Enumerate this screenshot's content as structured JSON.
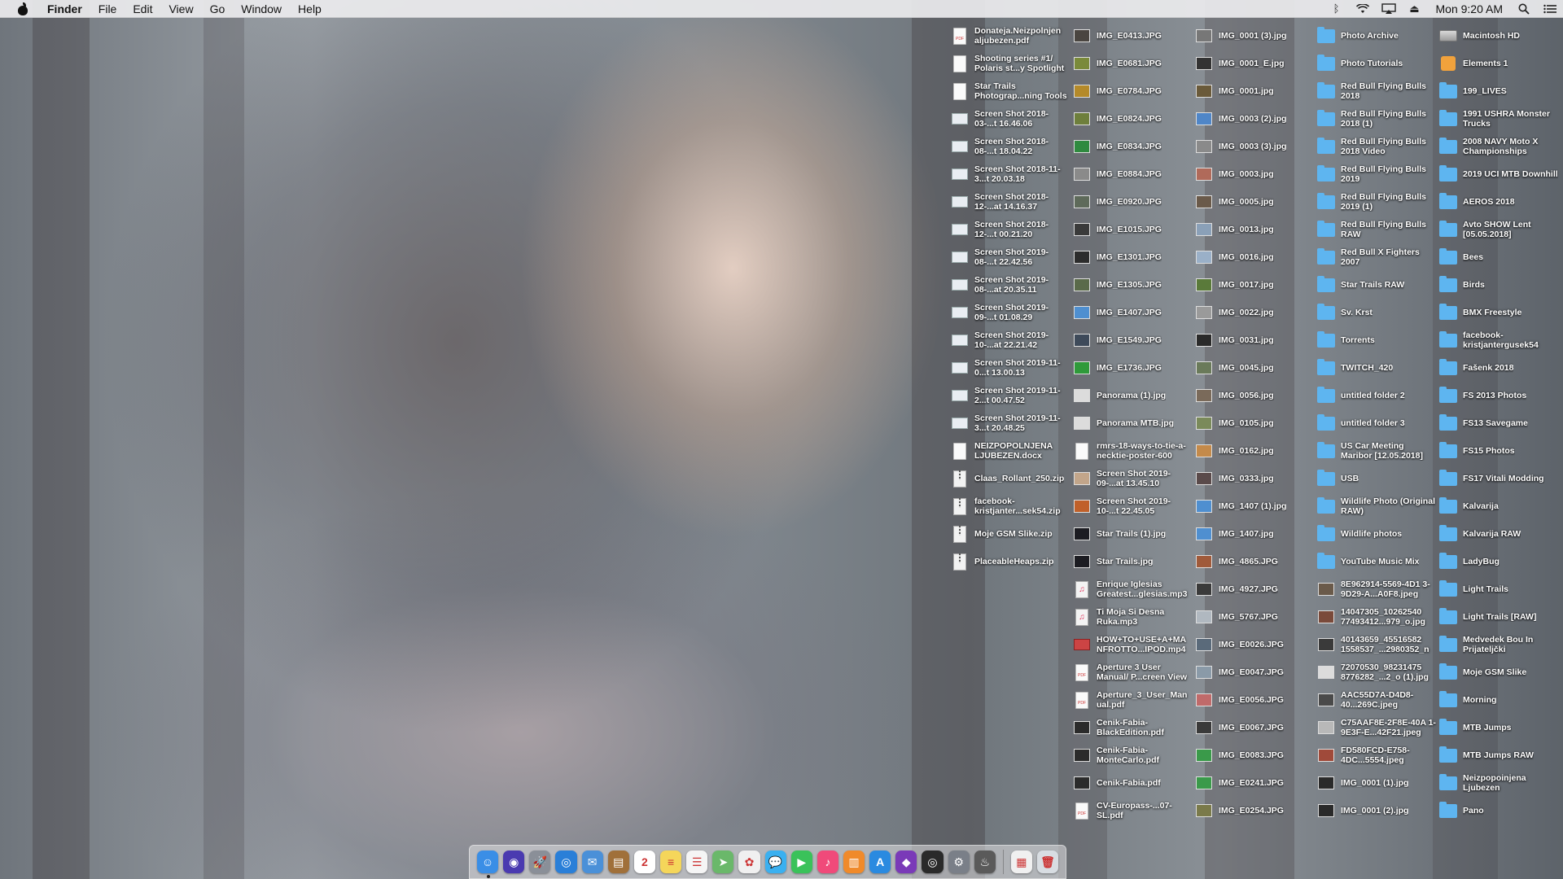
{
  "menubar": {
    "app_name": "Finder",
    "menus": [
      "File",
      "Edit",
      "View",
      "Go",
      "Window",
      "Help"
    ],
    "clock": "Mon 9:20 AM",
    "status_icons": [
      "bluetooth-icon",
      "wifi-icon",
      "airplay-icon",
      "eject-icon",
      "spotlight-search-icon",
      "notification-center-icon"
    ]
  },
  "desktop": {
    "columns": [
      {
        "items": [
          {
            "label": "Donateja.Neizpolnjen aljubezen.pdf",
            "icon": "pdf-icon"
          },
          {
            "label": "Shooting series #1/ Polaris st...y Spotlight",
            "icon": "document-icon"
          },
          {
            "label": "Star Trails Photograp...ning Tools",
            "icon": "document-icon"
          },
          {
            "label": "Screen Shot 2018-03-...t 16.46.06",
            "icon": "screenshot-icon"
          },
          {
            "label": "Screen Shot 2018-08-...t 18.04.22",
            "icon": "screenshot-icon"
          },
          {
            "label": "Screen Shot 2018-11-3...t 20.03.18",
            "icon": "screenshot-icon"
          },
          {
            "label": "Screen Shot 2018-12-...at 14.16.37",
            "icon": "screenshot-icon"
          },
          {
            "label": "Screen Shot 2018-12-...t 00.21.20",
            "icon": "screenshot-icon"
          },
          {
            "label": "Screen Shot 2019-08-...t 22.42.56",
            "icon": "screenshot-icon"
          },
          {
            "label": "Screen Shot 2019-08-...at 20.35.11",
            "icon": "screenshot-icon"
          },
          {
            "label": "Screen Shot 2019-09-...t 01.08.29",
            "icon": "screenshot-icon"
          },
          {
            "label": "Screen Shot 2019-10-...at 22.21.42",
            "icon": "screenshot-icon"
          },
          {
            "label": "Screen Shot 2019-11-0...t 13.00.13",
            "icon": "screenshot-icon"
          },
          {
            "label": "Screen Shot 2019-11-2...t 00.47.52",
            "icon": "screenshot-icon"
          },
          {
            "label": "Screen Shot 2019-11-3...t 20.48.25",
            "icon": "screenshot-icon"
          },
          {
            "label": "NEIZPOPOLNJENA LJUBEZEN.docx",
            "icon": "document-icon"
          },
          {
            "label": "Claas_Rollant_250.zip",
            "icon": "zip-icon"
          },
          {
            "label": "facebook-kristjanter...sek54.zip",
            "icon": "zip-icon"
          },
          {
            "label": "Moje GSM Slike.zip",
            "icon": "zip-icon"
          },
          {
            "label": "PlaceableHeaps.zip",
            "icon": "zip-icon"
          }
        ]
      },
      {
        "items": [
          {
            "label": "IMG_E0413.JPG",
            "icon": "image-icon",
            "tint": "#4a4540"
          },
          {
            "label": "IMG_E0681.JPG",
            "icon": "image-icon",
            "tint": "#7a8a3a"
          },
          {
            "label": "IMG_E0784.JPG",
            "icon": "image-icon",
            "tint": "#b58a2a"
          },
          {
            "label": "IMG_E0824.JPG",
            "icon": "image-icon",
            "tint": "#6e7f3c"
          },
          {
            "label": "IMG_E0834.JPG",
            "icon": "image-icon",
            "tint": "#2f8a3f"
          },
          {
            "label": "IMG_E0884.JPG",
            "icon": "image-icon",
            "tint": "#8a8a8a"
          },
          {
            "label": "IMG_E0920.JPG",
            "icon": "image-icon",
            "tint": "#5e6a5a"
          },
          {
            "label": "IMG_E1015.JPG",
            "icon": "image-icon",
            "tint": "#3a3a3a"
          },
          {
            "label": "IMG_E1301.JPG",
            "icon": "image-icon",
            "tint": "#2c2c2c"
          },
          {
            "label": "IMG_E1305.JPG",
            "icon": "image-icon",
            "tint": "#5a6a4a"
          },
          {
            "label": "IMG_E1407.JPG",
            "icon": "image-icon",
            "tint": "#4f8fd0"
          },
          {
            "label": "IMG_E1549.JPG",
            "icon": "image-icon",
            "tint": "#3e4a5a"
          },
          {
            "label": "IMG_E1736.JPG",
            "icon": "image-icon",
            "tint": "#2f9a3a"
          },
          {
            "label": "Panorama (1).jpg",
            "icon": "image-icon",
            "tint": "#dcdcdc"
          },
          {
            "label": "Panorama MTB.jpg",
            "icon": "image-icon",
            "tint": "#dcdcdc"
          },
          {
            "label": "rmrs-18-ways-to-tie-a-necktie-poster-600",
            "icon": "document-icon"
          },
          {
            "label": "Screen Shot 2019-09-...at 13.45.10",
            "icon": "image-icon",
            "tint": "#c2a58a"
          },
          {
            "label": "Screen Shot 2019-10-...t 22.45.05",
            "icon": "image-icon",
            "tint": "#c0602a"
          },
          {
            "label": "Star Trails (1).jpg",
            "icon": "image-icon",
            "tint": "#1c1c22"
          },
          {
            "label": "Star Trails.jpg",
            "icon": "image-icon",
            "tint": "#1c1c22"
          },
          {
            "label": "Enrique Iglesias Greatest...glesias.mp3",
            "icon": "audio-icon"
          },
          {
            "label": "Ti Moja Si Desna Ruka.mp3",
            "icon": "audio-icon"
          },
          {
            "label": "HOW+TO+USE+A+MA NFROTTO...IPOD.mp4",
            "icon": "video-icon"
          },
          {
            "label": "Aperture 3 User Manual/ P...creen View",
            "icon": "pdf-icon"
          },
          {
            "label": "Aperture_3_User_Man ual.pdf",
            "icon": "pdf-icon"
          },
          {
            "label": "Cenik-Fabia-BlackEdition.pdf",
            "icon": "image-icon",
            "tint": "#2b2b2b"
          },
          {
            "label": "Cenik-Fabia-MonteCarlo.pdf",
            "icon": "image-icon",
            "tint": "#2b2b2b"
          },
          {
            "label": "Cenik-Fabia.pdf",
            "icon": "image-icon",
            "tint": "#2b2b2b"
          },
          {
            "label": "CV-Europass-...07-SL.pdf",
            "icon": "pdf-icon"
          }
        ]
      },
      {
        "items": [
          {
            "label": "IMG_0001 (3).jpg",
            "icon": "image-icon",
            "tint": "#777777"
          },
          {
            "label": "IMG_0001_E.jpg",
            "icon": "image-icon",
            "tint": "#333333"
          },
          {
            "label": "IMG_0001.jpg",
            "icon": "image-icon",
            "tint": "#6a5a3a"
          },
          {
            "label": "IMG_0003 (2).jpg",
            "icon": "image-icon",
            "tint": "#4f86c8"
          },
          {
            "label": "IMG_0003 (3).jpg",
            "icon": "image-icon",
            "tint": "#8a8a8a"
          },
          {
            "label": "IMG_0003.jpg",
            "icon": "image-icon",
            "tint": "#b06a5a"
          },
          {
            "label": "IMG_0005.jpg",
            "icon": "image-icon",
            "tint": "#6a5a4a"
          },
          {
            "label": "IMG_0013.jpg",
            "icon": "image-icon",
            "tint": "#8aa0b8"
          },
          {
            "label": "IMG_0016.jpg",
            "icon": "image-icon",
            "tint": "#9ab0c8"
          },
          {
            "label": "IMG_0017.jpg",
            "icon": "image-icon",
            "tint": "#5a7a3a"
          },
          {
            "label": "IMG_0022.jpg",
            "icon": "image-icon",
            "tint": "#9a9a9a"
          },
          {
            "label": "IMG_0031.jpg",
            "icon": "image-icon",
            "tint": "#2a2a2a"
          },
          {
            "label": "IMG_0045.jpg",
            "icon": "image-icon",
            "tint": "#6a7a5a"
          },
          {
            "label": "IMG_0056.jpg",
            "icon": "image-icon",
            "tint": "#7a6a5a"
          },
          {
            "label": "IMG_0105.jpg",
            "icon": "image-icon",
            "tint": "#7a8a5a"
          },
          {
            "label": "IMG_0162.jpg",
            "icon": "image-icon",
            "tint": "#c48a4a"
          },
          {
            "label": "IMG_0333.jpg",
            "icon": "image-icon",
            "tint": "#5a4a4a"
          },
          {
            "label": "IMG_1407 (1).jpg",
            "icon": "image-icon",
            "tint": "#4f8fd0"
          },
          {
            "label": "IMG_1407.jpg",
            "icon": "image-icon",
            "tint": "#4f8fd0"
          },
          {
            "label": "IMG_4865.JPG",
            "icon": "image-icon",
            "tint": "#a05a3a"
          },
          {
            "label": "IMG_4927.JPG",
            "icon": "image-icon",
            "tint": "#3a3a3a"
          },
          {
            "label": "IMG_5767.JPG",
            "icon": "image-icon",
            "tint": "#b0b8c0"
          },
          {
            "label": "IMG_E0026.JPG",
            "icon": "image-icon",
            "tint": "#5a6a7a"
          },
          {
            "label": "IMG_E0047.JPG",
            "icon": "image-icon",
            "tint": "#8a9aa8"
          },
          {
            "label": "IMG_E0056.JPG",
            "icon": "image-icon",
            "tint": "#c06a6a"
          },
          {
            "label": "IMG_E0067.JPG",
            "icon": "image-icon",
            "tint": "#3a3a3a"
          },
          {
            "label": "IMG_E0083.JPG",
            "icon": "image-icon",
            "tint": "#3a9a4a"
          },
          {
            "label": "IMG_E0241.JPG",
            "icon": "image-icon",
            "tint": "#3a9a4a"
          },
          {
            "label": "IMG_E0254.JPG",
            "icon": "image-icon",
            "tint": "#7a7a4a"
          }
        ]
      },
      {
        "items": [
          {
            "label": "Photo Archive",
            "icon": "folder-icon"
          },
          {
            "label": "Photo Tutorials",
            "icon": "folder-icon"
          },
          {
            "label": "Red Bull Flying Bulls 2018",
            "icon": "folder-icon"
          },
          {
            "label": "Red Bull Flying Bulls 2018 (1)",
            "icon": "folder-icon"
          },
          {
            "label": "Red Bull Flying Bulls 2018 Video",
            "icon": "folder-icon"
          },
          {
            "label": "Red Bull Flying Bulls 2019",
            "icon": "folder-icon"
          },
          {
            "label": "Red Bull Flying Bulls 2019 (1)",
            "icon": "folder-icon"
          },
          {
            "label": "Red Bull Flying Bulls RAW",
            "icon": "folder-icon"
          },
          {
            "label": "Red Bull X Fighters 2007",
            "icon": "folder-icon"
          },
          {
            "label": "Star Trails RAW",
            "icon": "folder-icon"
          },
          {
            "label": "Sv. Krst",
            "icon": "folder-icon"
          },
          {
            "label": "Torrents",
            "icon": "folder-icon"
          },
          {
            "label": "TWITCH_420",
            "icon": "folder-icon"
          },
          {
            "label": "untitled folder 2",
            "icon": "folder-icon"
          },
          {
            "label": "untitled folder 3",
            "icon": "folder-icon"
          },
          {
            "label": "US Car Meeting Maribor [12.05.2018]",
            "icon": "folder-icon"
          },
          {
            "label": "USB",
            "icon": "folder-icon"
          },
          {
            "label": "Wildlife Photo (Original RAW)",
            "icon": "folder-icon"
          },
          {
            "label": "Wildlife photos",
            "icon": "folder-icon"
          },
          {
            "label": "YouTube Music Mix",
            "icon": "folder-icon"
          },
          {
            "label": "8E962914-5569-4D1 3-9D29-A...A0F8.jpeg",
            "icon": "image-icon",
            "tint": "#6a5a4a"
          },
          {
            "label": "14047305_10262540 77493412...979_o.jpg",
            "icon": "image-icon",
            "tint": "#7a4a3a"
          },
          {
            "label": "40143659_45516582 1558537_...2980352_n",
            "icon": "image-icon",
            "tint": "#3a3a3a"
          },
          {
            "label": "72070530_98231475 8776282_...2_o (1).jpg",
            "icon": "image-icon",
            "tint": "#dcdcdc"
          },
          {
            "label": "AAC55D7A-D4D8-40...269C.jpeg",
            "icon": "image-icon",
            "tint": "#4a4a4a"
          },
          {
            "label": "C75AAF8E-2F8E-40A 1-9E3F-E...42F21.jpeg",
            "icon": "image-icon",
            "tint": "#b8b8b8"
          },
          {
            "label": "FD580FCD-E758-4DC...5554.jpeg",
            "icon": "image-icon",
            "tint": "#a04a3a"
          },
          {
            "label": "IMG_0001 (1).jpg",
            "icon": "image-icon",
            "tint": "#2a2a2a"
          },
          {
            "label": "IMG_0001 (2).jpg",
            "icon": "image-icon",
            "tint": "#2a2a2a"
          }
        ]
      },
      {
        "items": [
          {
            "label": "Macintosh HD",
            "icon": "hard-drive-icon"
          },
          {
            "label": "Elements 1",
            "icon": "app-icon"
          },
          {
            "label": "199_LIVES",
            "icon": "folder-icon"
          },
          {
            "label": "1991 USHRA Monster Trucks",
            "icon": "folder-icon"
          },
          {
            "label": "2008 NAVY Moto X Championships",
            "icon": "folder-icon"
          },
          {
            "label": "2019 UCI MTB Downhill",
            "icon": "folder-icon"
          },
          {
            "label": "AEROS 2018",
            "icon": "folder-icon"
          },
          {
            "label": "Avto SHOW Lent [05.05.2018]",
            "icon": "folder-icon"
          },
          {
            "label": "Bees",
            "icon": "folder-icon"
          },
          {
            "label": "Birds",
            "icon": "folder-icon"
          },
          {
            "label": "BMX Freestyle",
            "icon": "folder-icon"
          },
          {
            "label": "facebook-kristjantergusek54",
            "icon": "folder-icon"
          },
          {
            "label": "Fašenk 2018",
            "icon": "folder-icon"
          },
          {
            "label": "FS 2013 Photos",
            "icon": "folder-icon"
          },
          {
            "label": "FS13 Savegame",
            "icon": "folder-icon"
          },
          {
            "label": "FS15 Photos",
            "icon": "folder-icon"
          },
          {
            "label": "FS17 Vitali Modding",
            "icon": "folder-icon"
          },
          {
            "label": "Kalvarija",
            "icon": "folder-icon"
          },
          {
            "label": "Kalvarija RAW",
            "icon": "folder-icon"
          },
          {
            "label": "LadyBug",
            "icon": "folder-icon"
          },
          {
            "label": "Light Trails",
            "icon": "folder-icon"
          },
          {
            "label": "Light Trails [RAW]",
            "icon": "folder-icon"
          },
          {
            "label": "Medvedek Bou In Prijateljčki",
            "icon": "folder-icon"
          },
          {
            "label": "Moje GSM Slike",
            "icon": "folder-icon"
          },
          {
            "label": "Morning",
            "icon": "folder-icon"
          },
          {
            "label": "MTB Jumps",
            "icon": "folder-icon"
          },
          {
            "label": "MTB Jumps RAW",
            "icon": "folder-icon"
          },
          {
            "label": "Neizpopoinjena Ljubezen",
            "icon": "folder-icon"
          },
          {
            "label": "Pano",
            "icon": "folder-icon"
          }
        ]
      }
    ]
  },
  "dock": {
    "apps": [
      {
        "name": "finder-icon",
        "color": "#3a8ee6",
        "glyph": "☺",
        "running": true
      },
      {
        "name": "siri-icon",
        "color": "#4a3ab0",
        "glyph": "◉"
      },
      {
        "name": "launchpad-icon",
        "color": "#8a8f98",
        "glyph": "🚀"
      },
      {
        "name": "safari-icon",
        "color": "#2a7fd8",
        "glyph": "◎"
      },
      {
        "name": "mail-icon",
        "color": "#4a90d8",
        "glyph": "✉"
      },
      {
        "name": "notefile-icon",
        "color": "#a0703a",
        "glyph": "▤"
      },
      {
        "name": "calendar-icon",
        "color": "#ffffff",
        "glyph": "2"
      },
      {
        "name": "notes-icon",
        "color": "#f5d65a",
        "glyph": "≡"
      },
      {
        "name": "reminders-icon",
        "color": "#f5f5f5",
        "glyph": "☰"
      },
      {
        "name": "maps-icon",
        "color": "#6ab86a",
        "glyph": "➤"
      },
      {
        "name": "photos-icon",
        "color": "#f0f0f0",
        "glyph": "✿"
      },
      {
        "name": "messages-icon",
        "color": "#3ab0f0",
        "glyph": "💬"
      },
      {
        "name": "facetime-icon",
        "color": "#3ac25a",
        "glyph": "▶"
      },
      {
        "name": "itunes-icon",
        "color": "#f04a7a",
        "glyph": "♪"
      },
      {
        "name": "books-icon",
        "color": "#f08a2a",
        "glyph": "▥"
      },
      {
        "name": "app-store-icon",
        "color": "#2a8ae0",
        "glyph": "A"
      },
      {
        "name": "affinity-photo-icon",
        "color": "#7a3ab8",
        "glyph": "◆"
      },
      {
        "name": "aperture-icon",
        "color": "#2a2a2a",
        "glyph": "◎"
      },
      {
        "name": "system-preferences-icon",
        "color": "#7a7f88",
        "glyph": "⚙"
      },
      {
        "name": "activity-monitor-icon",
        "color": "#5a5a5a",
        "glyph": "♨"
      }
    ],
    "right_items": [
      {
        "name": "documents-stack-icon",
        "color": "#f0f0f0",
        "glyph": "▦"
      },
      {
        "name": "trash-icon",
        "color": "#d8dde2",
        "glyph": "🗑"
      }
    ]
  }
}
